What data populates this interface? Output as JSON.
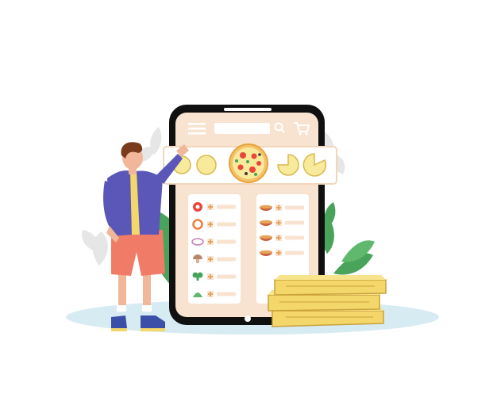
{
  "palette": {
    "phone_body": "#101010",
    "screen_bg": "#f7e3cf",
    "panel_bg": "#ffffff",
    "pizza_yellow": "#f7ea9a",
    "pizza_outline": "#d9b84e",
    "accent_red": "#e8463c",
    "ground": "#d7ebf3",
    "leaf_green": "#4aa35a",
    "leaf_light": "#e6e6e6",
    "box_yellow": "#f4d76a",
    "box_edge": "#c9a23c",
    "shirt_blue": "#5b57b8",
    "shorts_red": "#f07b67",
    "skin": "#f2b79a",
    "hair": "#7a3b1c"
  },
  "ingredients_left": [
    {
      "icon": "tomato-icon"
    },
    {
      "icon": "bell-pepper-icon"
    },
    {
      "icon": "onion-ring-icon"
    },
    {
      "icon": "mushroom-icon"
    },
    {
      "icon": "broccoli-icon"
    },
    {
      "icon": "herb-icon"
    }
  ],
  "sauces_right": [
    {
      "icon": "sauce-bowl-icon"
    },
    {
      "icon": "sauce-bowl-icon"
    },
    {
      "icon": "sauce-bowl-icon"
    },
    {
      "icon": "sauce-bowl-icon"
    }
  ],
  "pizza_size_options": [
    {
      "icon": "pizza-plain-icon"
    },
    {
      "icon": "pizza-plain-icon"
    },
    {
      "icon": "pizza-with-toppings-icon"
    },
    {
      "icon": "pizza-slice-removed-icon"
    },
    {
      "icon": "pizza-slice-removed-icon"
    }
  ]
}
